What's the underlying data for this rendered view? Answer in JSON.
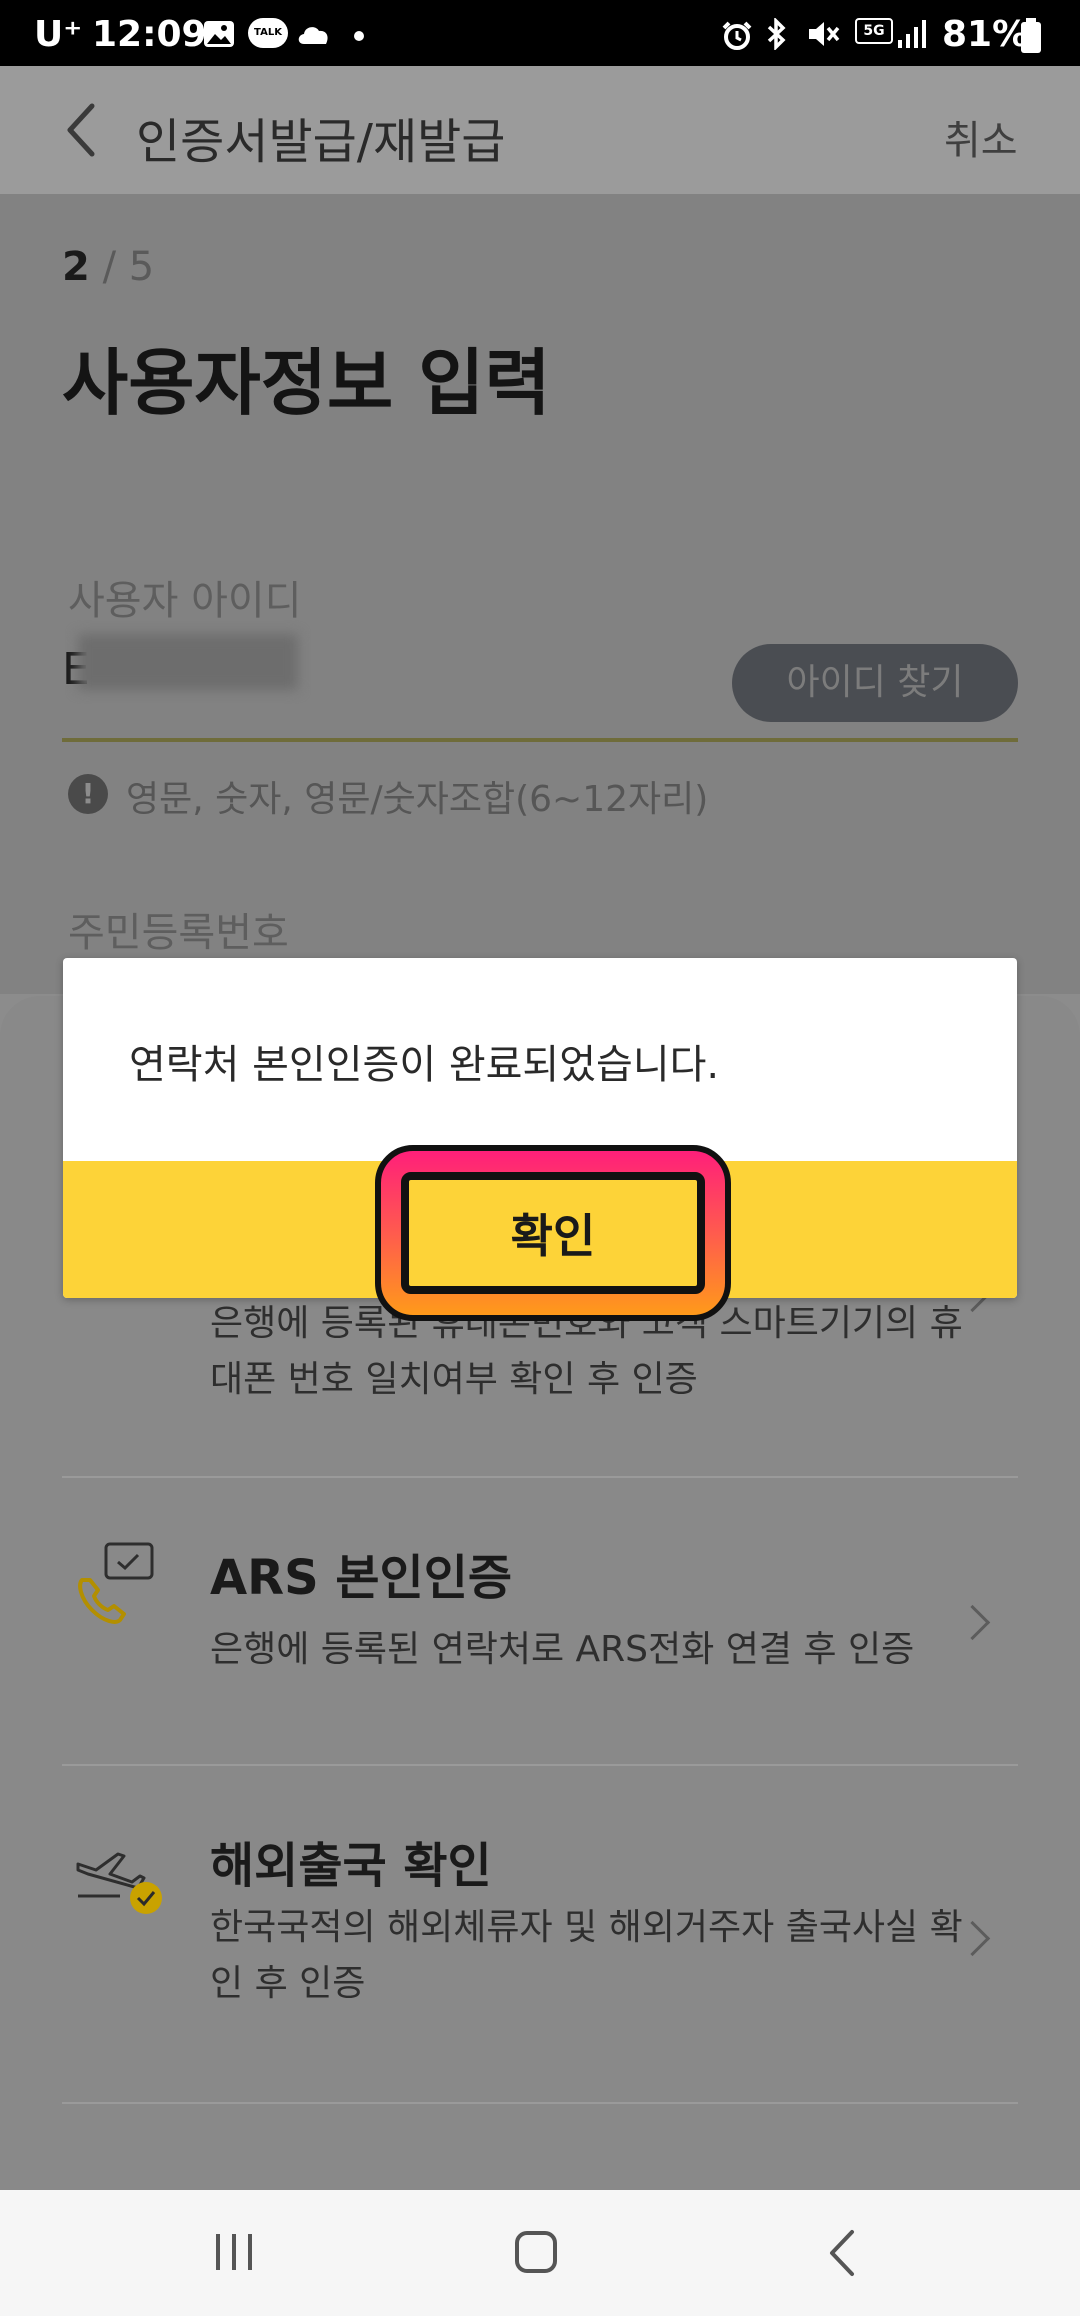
{
  "status_bar": {
    "carrier": "U⁺",
    "time": "12:09",
    "talk_badge": "TALK",
    "network": "5G",
    "battery": "81%"
  },
  "header": {
    "title": "인증서발급/재발급",
    "cancel_label": "취소"
  },
  "form": {
    "step_current": "2",
    "step_total": "/ 5",
    "page_title": "사용자정보 입력",
    "user_id_label": "사용자 아이디",
    "user_id_value_visible": "E",
    "find_id_button": "아이디 찾기",
    "user_id_hint": "영문, 숫자, 영문/숫자조합(6~12자리)",
    "resident_number_label": "주민등록번호"
  },
  "verify_methods": [
    {
      "title": "",
      "description": [
        "은행에 등록된 휴대폰번호와 고객 스마트기기의 휴",
        "대폰 번호 일치여부 확인 후 인증"
      ]
    },
    {
      "title": "ARS 본인인증",
      "description": [
        "은행에 등록된 연락처로 ARS전화 연결 후 인증"
      ]
    },
    {
      "title": "해외출국 확인",
      "description": [
        "한국국적의 해외체류자 및 해외거주자 출국사실 확",
        "인 후 인증"
      ]
    }
  ],
  "dialog": {
    "message": "연락처 본인인증이 완료되었습니다.",
    "confirm_label": "확인"
  },
  "colors": {
    "accent_yellow": "#fdd338",
    "highlight_pink": "#ff1f7a",
    "highlight_orange": "#ff9a1a",
    "icon_gold": "#c9a200"
  },
  "icons": [
    "back-arrow-icon",
    "phone-chat-icon",
    "plane-check-icon",
    "chevron-right-icon",
    "info-icon"
  ]
}
